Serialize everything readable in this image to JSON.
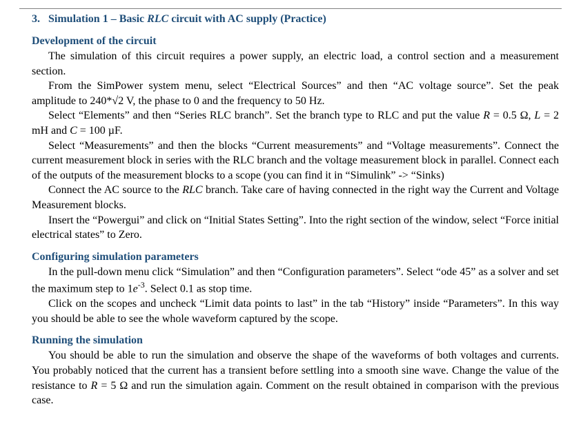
{
  "header": {
    "number": "3.",
    "title_prefix": "Simulation 1 – Basic ",
    "title_ital": "RLC",
    "title_suffix": " circuit with AC supply (Practice)"
  },
  "section1": {
    "heading": "Development of the circuit",
    "p1": "The simulation of this circuit requires a power supply, an electric load, a control section and a measurement section.",
    "p2": "From the SimPower system menu, select “Electrical Sources” and then “AC voltage source”. Set the peak amplitude to 240*√2 V, the phase to 0 and the frequency to 50 Hz.",
    "p3a": "Select “Elements” and then “Series RLC branch”. Set the branch type to RLC and put the value ",
    "p3_R": "R",
    "p3b": " = 0.5 Ω, ",
    "p3_L": "L",
    "p3c": " = 2 mH and ",
    "p3_C": "C",
    "p3d": " = 100 µF.",
    "p4": "Select “Measurements” and then the blocks “Current measurements” and “Voltage measurements”. Connect the current measurement block in series with the RLC branch and the voltage measurement block in parallel. Connect each of the outputs of the measurement blocks to a scope (you can find it in “Simulink” -> “Sinks)",
    "p5a": "Connect the AC source to the ",
    "p5_ital": "RLC",
    "p5b": " branch. Take care of having connected in the right way the Current and Voltage Measurement blocks.",
    "p6": "Insert the “Powergui” and click on “Initial States Setting”. Into the right section of the window, select “Force initial electrical states” to Zero."
  },
  "section2": {
    "heading": "Configuring simulation parameters",
    "p1a": "In the pull-down menu click “Simulation” and then “Configuration parameters”.  Select “ode 45” as a solver and set the maximum step to 1",
    "p1_ital": "e",
    "p1_sup": "-3",
    "p1b": ". Select 0.1 as stop time.",
    "p2": "Click on the scopes and uncheck “Limit data points to last” in the tab “History” inside “Parameters”. In this way you should be able to see the whole waveform captured by the scope."
  },
  "section3": {
    "heading": "Running the simulation",
    "p1a": "You should be able to run the simulation and observe the shape of the waveforms of both voltages and currents. You probably noticed that the current has a transient before settling into a smooth sine wave. Change the value of the resistance to ",
    "p1_R": "R",
    "p1b": " = 5 Ω and run the simulation again. Comment on the result obtained in comparison with the previous case."
  }
}
